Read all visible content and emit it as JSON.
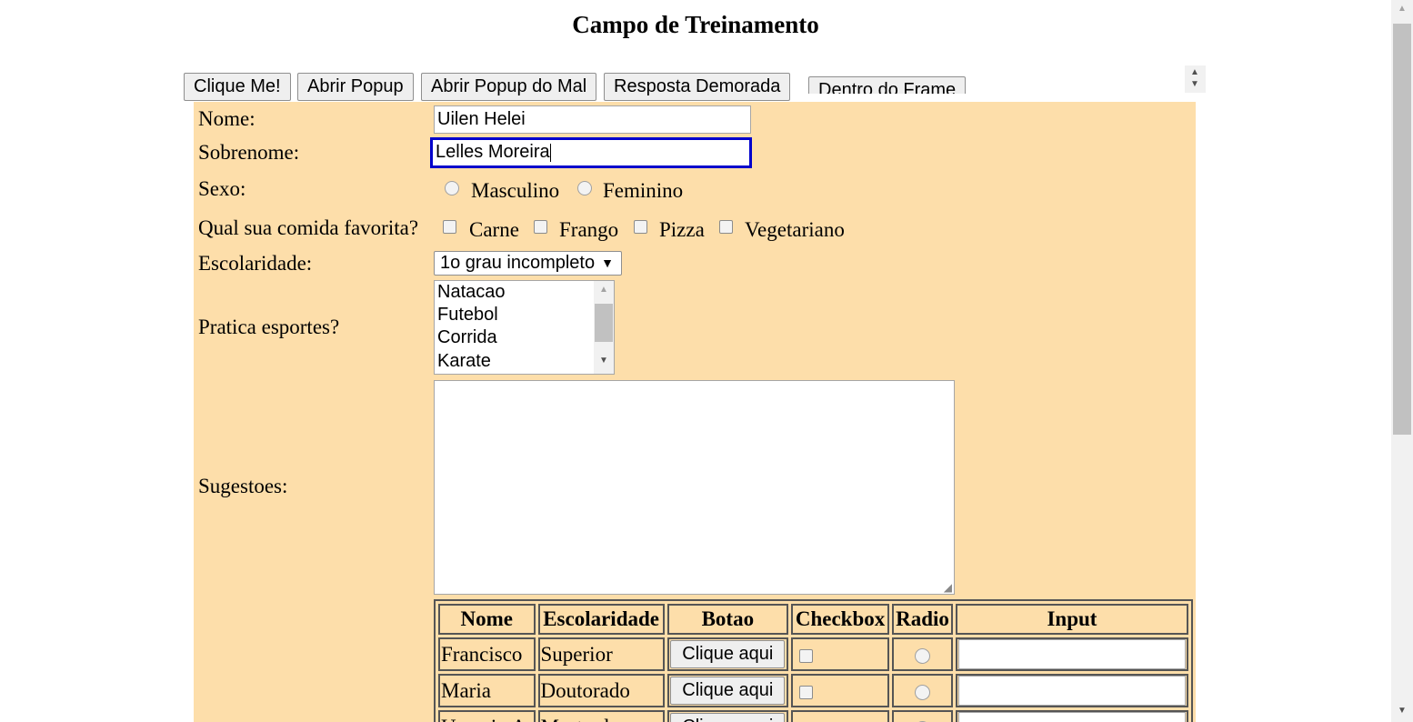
{
  "page": {
    "title": "Campo de Treinamento"
  },
  "toolbar": {
    "click_me": "Clique Me!",
    "open_popup": "Abrir Popup",
    "open_evil_popup": "Abrir Popup do Mal",
    "slow_response": "Resposta Demorada",
    "inside_frame": "Dentro do Frame"
  },
  "form": {
    "nome": {
      "label": "Nome:",
      "value": "Uilen Helei"
    },
    "sobrenome": {
      "label": "Sobrenome:",
      "value": "Lelles Moreira"
    },
    "sexo": {
      "label": "Sexo:",
      "options": [
        "Masculino",
        "Feminino"
      ]
    },
    "comida": {
      "label": "Qual sua comida favorita?",
      "options": [
        "Carne",
        "Frango",
        "Pizza",
        "Vegetariano"
      ]
    },
    "escolaridade": {
      "label": "Escolaridade:",
      "selected": "1o grau incompleto"
    },
    "esportes": {
      "label": "Pratica esportes?",
      "options": [
        "Natacao",
        "Futebol",
        "Corrida",
        "Karate"
      ]
    },
    "sugestoes": {
      "label": "Sugestoes:",
      "value": ""
    }
  },
  "table": {
    "headers": [
      "Nome",
      "Escolaridade",
      "Botao",
      "Checkbox",
      "Radio",
      "Input"
    ],
    "button_label": "Clique aqui",
    "rows": [
      {
        "nome": "Francisco",
        "escolaridade": "Superior"
      },
      {
        "nome": "Maria",
        "escolaridade": "Doutorado"
      },
      {
        "nome": "Usuario A",
        "escolaridade": "Mestrado"
      }
    ]
  }
}
